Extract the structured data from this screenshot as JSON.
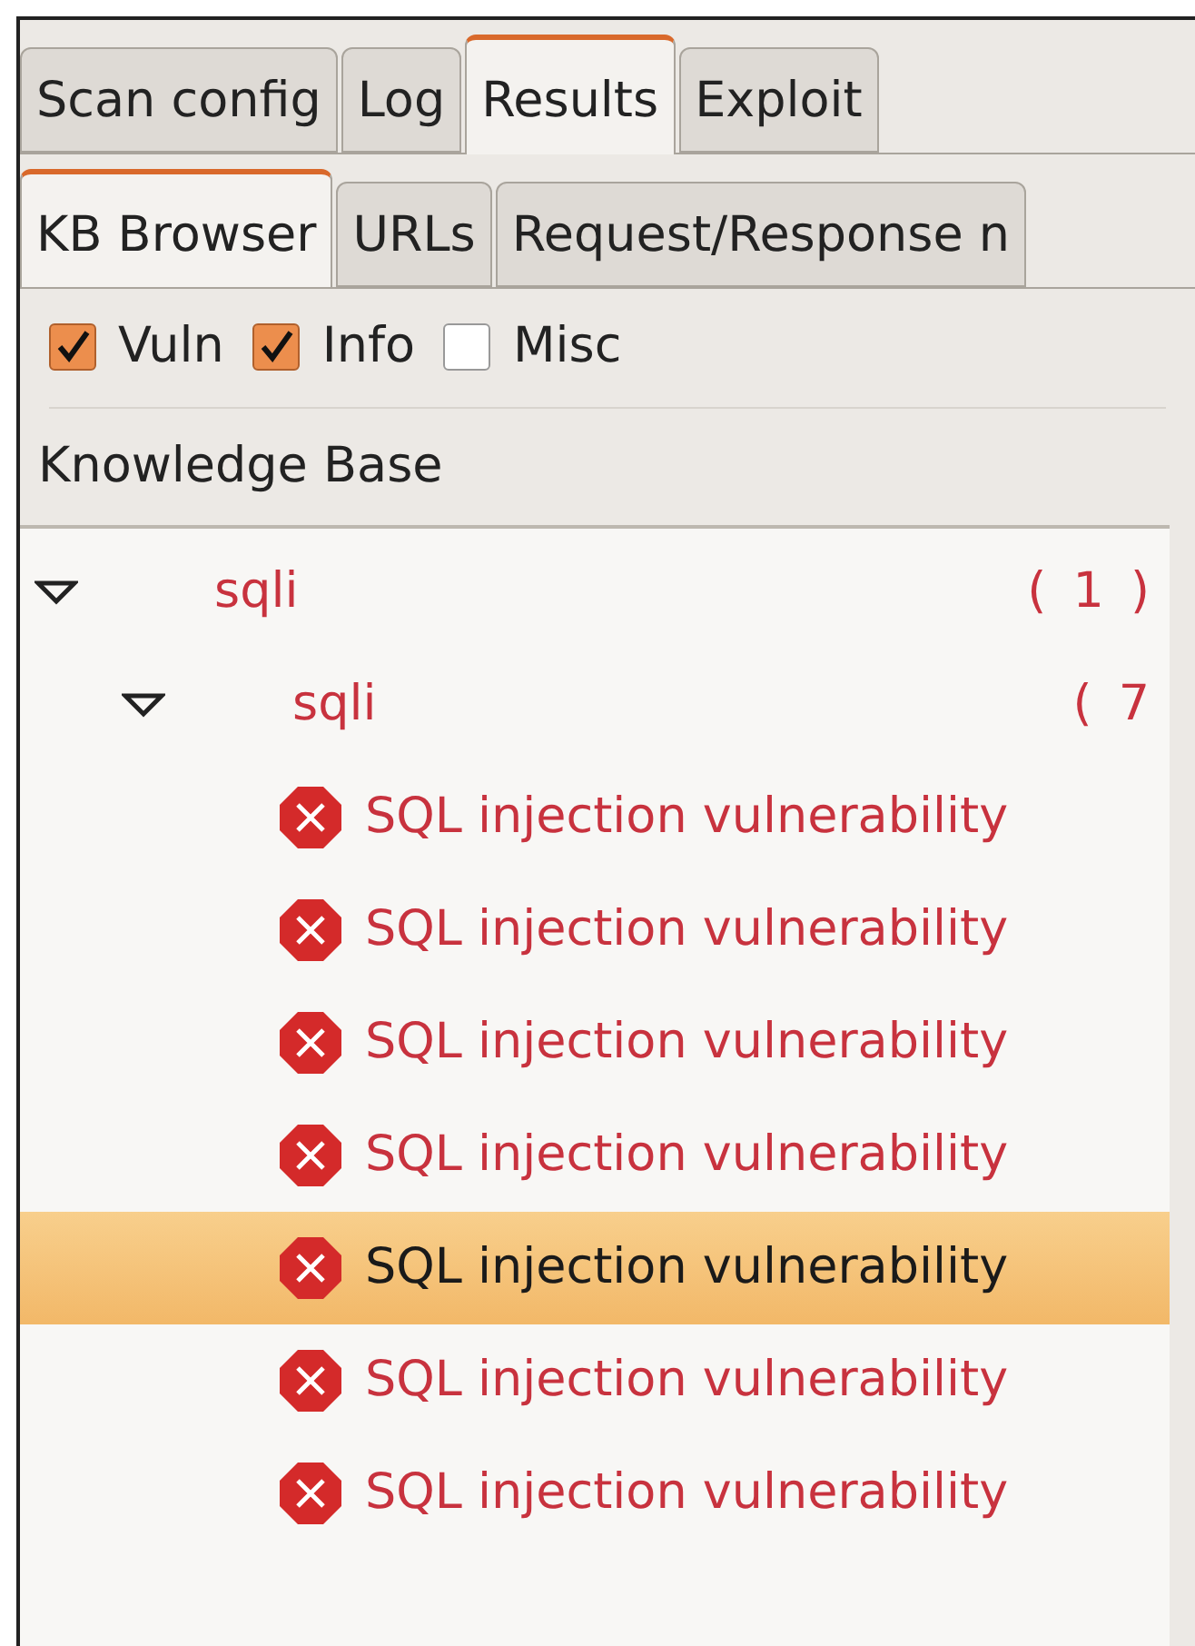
{
  "tabs": [
    {
      "label": "Scan config",
      "selected": false
    },
    {
      "label": "Log",
      "selected": false
    },
    {
      "label": "Results",
      "selected": true
    },
    {
      "label": "Exploit",
      "selected": false
    }
  ],
  "subtabs": [
    {
      "label": "KB Browser",
      "selected": true
    },
    {
      "label": "URLs",
      "selected": false
    },
    {
      "label": "Request/Response n",
      "selected": false
    }
  ],
  "filters": [
    {
      "label": "Vuln",
      "checked": true
    },
    {
      "label": "Info",
      "checked": true
    },
    {
      "label": "Misc",
      "checked": false
    }
  ],
  "tree": {
    "header": "Knowledge Base",
    "nodes": [
      {
        "kind": "folder",
        "label": "sqli",
        "count": "( 1 )",
        "expanded": true,
        "children": [
          {
            "kind": "folder",
            "label": "sqli",
            "count": "( 7",
            "expanded": true,
            "children": [
              {
                "kind": "vuln",
                "label": "SQL injection vulnerability",
                "selected": false
              },
              {
                "kind": "vuln",
                "label": "SQL injection vulnerability",
                "selected": false
              },
              {
                "kind": "vuln",
                "label": "SQL injection vulnerability",
                "selected": false
              },
              {
                "kind": "vuln",
                "label": "SQL injection vulnerability",
                "selected": false
              },
              {
                "kind": "vuln",
                "label": "SQL injection vulnerability",
                "selected": true
              },
              {
                "kind": "vuln",
                "label": "SQL injection vulnerability",
                "selected": false
              },
              {
                "kind": "vuln",
                "label": "SQL injection vulnerability",
                "selected": false
              }
            ]
          }
        ]
      }
    ]
  }
}
